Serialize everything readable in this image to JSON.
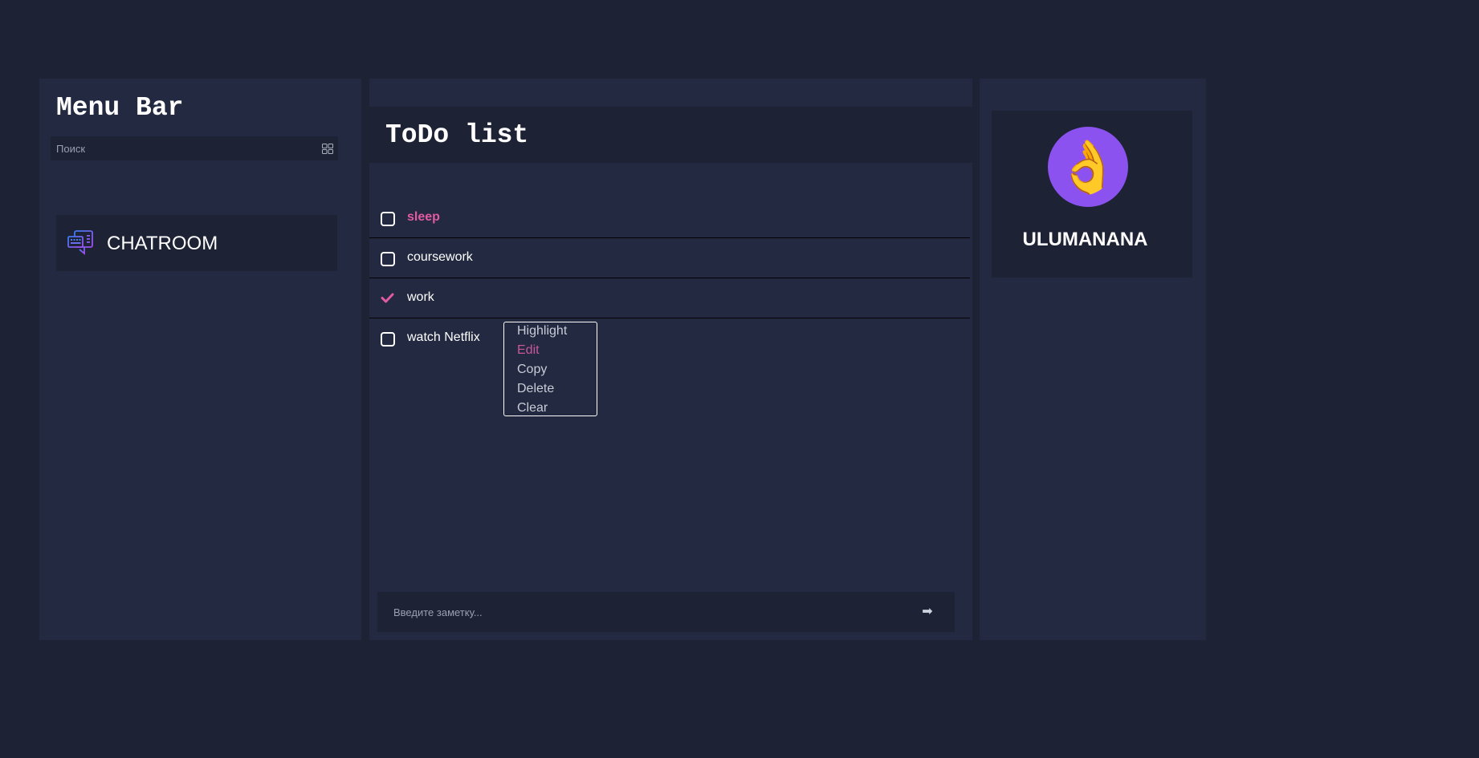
{
  "menu": {
    "title": "Menu Bar",
    "search": {
      "placeholder": "Поиск",
      "icon": "grid-icon"
    },
    "items": [
      {
        "label": "CHATROOM",
        "icon": "chat-keyboard-icon"
      }
    ]
  },
  "todo": {
    "title": "ToDo list",
    "items": [
      {
        "text": "sleep",
        "checked": false,
        "highlighted": true
      },
      {
        "text": "coursework",
        "checked": false,
        "highlighted": false
      },
      {
        "text": "work",
        "checked": true,
        "highlighted": false
      },
      {
        "text": "watch Netflix",
        "checked": false,
        "highlighted": false
      }
    ],
    "context_menu": {
      "items": [
        "Highlight",
        "Edit",
        "Copy",
        "Delete",
        "Clear"
      ],
      "active_item": "Edit"
    },
    "input": {
      "placeholder": "Введите заметку...",
      "send_icon": "➡"
    }
  },
  "profile": {
    "avatar_emoji": "👌",
    "name": "ULUMANANA"
  },
  "colors": {
    "background": "#1e2235",
    "panel": "#222940",
    "accent_pink": "#e05aa4",
    "avatar_purple": "#8b52f0"
  }
}
